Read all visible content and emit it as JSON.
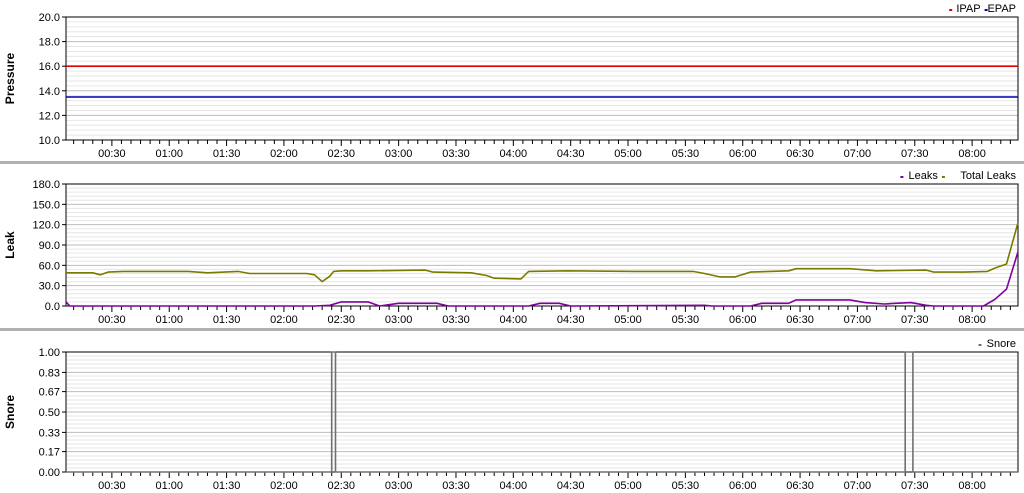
{
  "chart_data": [
    {
      "id": "pressure",
      "type": "line",
      "ylabel": "Pressure",
      "ylim": [
        10.0,
        20.0
      ],
      "y_ticks": [
        "10.0",
        "12.0",
        "14.0",
        "16.0",
        "18.0",
        "20.0"
      ],
      "x_range": [
        "00:06",
        "08:24"
      ],
      "x_ticks": [
        "00:30",
        "01:00",
        "01:30",
        "02:00",
        "02:30",
        "03:00",
        "03:30",
        "04:00",
        "04:30",
        "05:00",
        "05:30",
        "06:00",
        "06:30",
        "07:00",
        "07:30",
        "08:00"
      ],
      "grid": true,
      "legend_position": "top-right",
      "legend": [
        "IPAP",
        "EPAP"
      ],
      "series": [
        {
          "name": "IPAP",
          "color": "#e00000",
          "x": [
            "00:06",
            "08:24"
          ],
          "y": [
            16.0,
            16.0
          ]
        },
        {
          "name": "EPAP",
          "color": "#0000b0",
          "x": [
            "00:06",
            "08:24"
          ],
          "y": [
            13.5,
            13.5
          ]
        }
      ]
    },
    {
      "id": "leak",
      "type": "line",
      "ylabel": "Leak",
      "ylim": [
        0.0,
        180.0
      ],
      "y_ticks": [
        "0.0",
        "30.0",
        "60.0",
        "90.0",
        "120.0",
        "150.0",
        "180.0"
      ],
      "x_range": [
        "00:06",
        "08:24"
      ],
      "x_ticks": [
        "00:30",
        "01:00",
        "01:30",
        "02:00",
        "02:30",
        "03:00",
        "03:30",
        "04:00",
        "04:30",
        "05:00",
        "05:30",
        "06:00",
        "06:30",
        "07:00",
        "07:30",
        "08:00"
      ],
      "grid": true,
      "legend_position": "top-right",
      "legend": [
        "Leaks",
        "Total Leaks"
      ],
      "series": [
        {
          "name": "Total Leaks",
          "color": "#7a7a00",
          "x": [
            "00:06",
            "00:20",
            "00:24",
            "00:28",
            "00:36",
            "01:10",
            "01:20",
            "01:36",
            "01:42",
            "02:12",
            "02:16",
            "02:20",
            "02:24",
            "02:26",
            "02:30",
            "02:44",
            "03:14",
            "03:18",
            "03:38",
            "03:46",
            "03:50",
            "04:04",
            "04:08",
            "04:28",
            "05:04",
            "05:34",
            "05:40",
            "05:48",
            "05:56",
            "06:04",
            "06:24",
            "06:28",
            "06:56",
            "07:10",
            "07:36",
            "07:40",
            "07:56",
            "08:08",
            "08:12",
            "08:18",
            "08:24"
          ],
          "y": [
            49,
            49,
            46,
            50,
            51,
            51,
            49,
            51,
            48,
            48,
            46,
            36,
            44,
            51,
            52,
            52,
            53,
            50,
            49,
            45,
            41,
            40,
            51,
            52,
            51,
            51,
            48,
            43,
            43,
            50,
            52,
            55,
            55,
            52,
            53,
            50,
            50,
            51,
            56,
            62,
            123
          ]
        },
        {
          "name": "Leaks",
          "color": "#8000a0",
          "x": [
            "00:06",
            "00:08",
            "02:16",
            "02:24",
            "02:30",
            "02:44",
            "02:50",
            "03:00",
            "03:20",
            "03:26",
            "04:08",
            "04:14",
            "04:24",
            "04:30",
            "05:40",
            "05:44",
            "06:04",
            "06:10",
            "06:24",
            "06:28",
            "06:56",
            "07:04",
            "07:14",
            "07:20",
            "07:28",
            "07:36",
            "07:40",
            "08:06",
            "08:12",
            "08:18",
            "08:24"
          ],
          "y": [
            6,
            0,
            0,
            1,
            6,
            6,
            0,
            4,
            4,
            0,
            0,
            4,
            4,
            0,
            1,
            0,
            0,
            4,
            4,
            9,
            9,
            5,
            3,
            4,
            5,
            1,
            0,
            0,
            10,
            25,
            80
          ]
        }
      ]
    },
    {
      "id": "snore",
      "type": "line",
      "ylabel": "Snore",
      "ylim": [
        0.0,
        1.0
      ],
      "y_ticks": [
        "0.00",
        "0.17",
        "0.33",
        "0.50",
        "0.67",
        "0.83",
        "1.00"
      ],
      "x_range": [
        "00:06",
        "08:24"
      ],
      "x_ticks": [
        "00:30",
        "01:00",
        "01:30",
        "02:00",
        "02:30",
        "03:00",
        "03:30",
        "04:00",
        "04:30",
        "05:00",
        "05:30",
        "06:00",
        "06:30",
        "07:00",
        "07:30",
        "08:00"
      ],
      "grid": true,
      "legend_position": "top-right",
      "legend": [
        "Snore"
      ],
      "series": [
        {
          "name": "Snore",
          "color": "#707070",
          "x": [
            "00:06",
            "02:25",
            "02:25",
            "02:27",
            "02:27",
            "07:25",
            "07:25",
            "07:29",
            "07:29",
            "08:24"
          ],
          "y": [
            0,
            0,
            1,
            1,
            0,
            0,
            1,
            1,
            0,
            0
          ]
        }
      ]
    }
  ]
}
